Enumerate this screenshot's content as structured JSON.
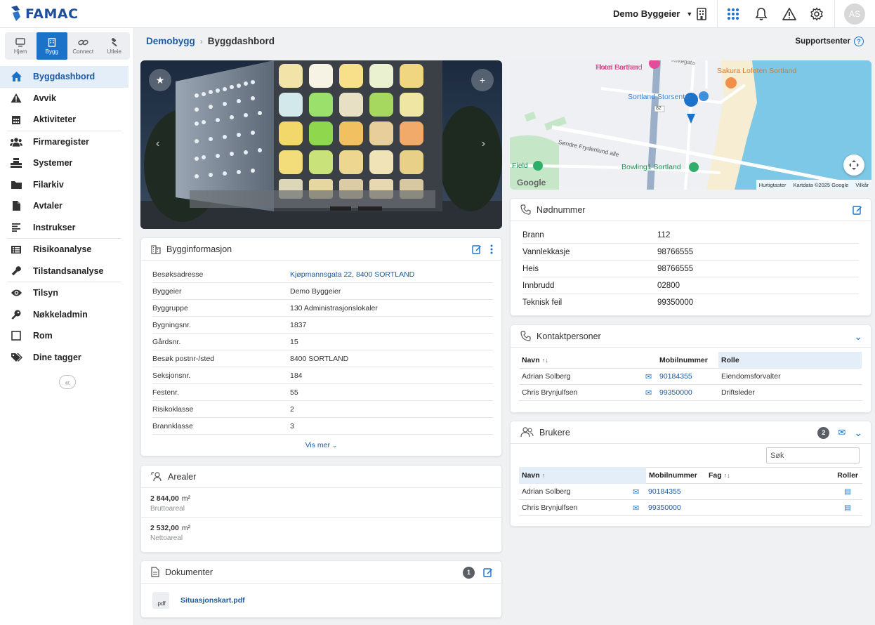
{
  "app": {
    "logo_text": "FAMAC"
  },
  "topbar": {
    "owner_select": "Demo Byggeier",
    "avatar_initials": "AS"
  },
  "modules": [
    {
      "label": "Hjem",
      "icon": "monitor-icon"
    },
    {
      "label": "Bygg",
      "icon": "building-icon",
      "active": true
    },
    {
      "label": "Connect",
      "icon": "link-icon"
    },
    {
      "label": "Utleie",
      "icon": "gavel-icon"
    }
  ],
  "nav": [
    {
      "label": "Byggdashbord",
      "icon": "home-icon",
      "active": true
    },
    {
      "label": "Avvik",
      "icon": "warning-icon"
    },
    {
      "label": "Aktiviteter",
      "icon": "calendar-icon"
    },
    {
      "label": "Firmaregister",
      "icon": "people-icon"
    },
    {
      "label": "Systemer",
      "icon": "cubes-icon"
    },
    {
      "label": "Filarkiv",
      "icon": "folder-icon"
    },
    {
      "label": "Avtaler",
      "icon": "file-icon"
    },
    {
      "label": "Instrukser",
      "icon": "lines-icon"
    },
    {
      "label": "Risikoanalyse",
      "icon": "list-icon"
    },
    {
      "label": "Tilstandsanalyse",
      "icon": "wrench-icon"
    },
    {
      "label": "Tilsyn",
      "icon": "eye-icon"
    },
    {
      "label": "Nøkkeladmin",
      "icon": "key-icon"
    },
    {
      "label": "Rom",
      "icon": "square-icon"
    },
    {
      "label": "Dine tagger",
      "icon": "tags-icon"
    }
  ],
  "breadcrumb": {
    "parent": "Demobygg",
    "current": "Byggdashbord"
  },
  "support": {
    "label": "Supportsenter"
  },
  "building_info": {
    "title": "Bygginformasjon",
    "rows": [
      {
        "key": "Besøksadresse",
        "value": "Kjøpmannsgata 22, 8400 SORTLAND",
        "link": true
      },
      {
        "key": "Byggeier",
        "value": "Demo Byggeier"
      },
      {
        "key": "Byggruppe",
        "value": "130 Administrasjonslokaler"
      },
      {
        "key": "Bygningsnr.",
        "value": "1837"
      },
      {
        "key": "Gårdsnr.",
        "value": "15"
      },
      {
        "key": "Besøk postnr-/sted",
        "value": "8400 SORTLAND"
      },
      {
        "key": "Seksjonsnr.",
        "value": "184"
      },
      {
        "key": "Festenr.",
        "value": "55"
      },
      {
        "key": "Risikoklasse",
        "value": "2"
      },
      {
        "key": "Brannklasse",
        "value": "3"
      }
    ],
    "show_more": "Vis mer"
  },
  "areas": {
    "title": "Arealer",
    "items": [
      {
        "value": "2 844,00",
        "unit": "m²",
        "label": "Bruttoareal"
      },
      {
        "value": "2 532,00",
        "unit": "m²",
        "label": "Nettoareal"
      }
    ]
  },
  "documents": {
    "title": "Dokumenter",
    "count": "1",
    "files": [
      {
        "ext": ".pdf",
        "name": "Situasjonskart.pdf"
      }
    ]
  },
  "map": {
    "labels": {
      "hotel": "Hotel Sortland",
      "hotel_top": "Thon Partner",
      "sakura": "Sakura Lofoten Sortland",
      "storsenter": "Sortland Storsenter",
      "road": "Søndre Frydenlund alle",
      "route": "82",
      "field": "Field",
      "bowling": "Bowling1 Sortland",
      "street_top": "Kirkegata",
      "google": "Google"
    },
    "footer": {
      "shortcuts": "Hurtigtaster",
      "mapdata": "Kartdata ©2025 Google",
      "terms": "Vilkår"
    }
  },
  "emergency": {
    "title": "Nødnummer",
    "rows": [
      {
        "key": "Brann",
        "value": "112"
      },
      {
        "key": "Vannlekkasje",
        "value": "98766555"
      },
      {
        "key": "Heis",
        "value": "98766555"
      },
      {
        "key": "Innbrudd",
        "value": "02800"
      },
      {
        "key": "Teknisk feil",
        "value": "99350000"
      }
    ]
  },
  "contacts": {
    "title": "Kontaktpersoner",
    "headers": {
      "name": "Navn",
      "mobile": "Mobilnummer",
      "role": "Rolle"
    },
    "rows": [
      {
        "name": "Adrian Solberg",
        "mobile": "90184355",
        "role": "Eiendomsforvalter"
      },
      {
        "name": "Chris Brynjulfsen",
        "mobile": "99350000",
        "role": "Driftsleder"
      }
    ]
  },
  "users": {
    "title": "Brukere",
    "count": "2",
    "search_placeholder": "Søk",
    "headers": {
      "name": "Navn",
      "mobile": "Mobilnummer",
      "discipline": "Fag",
      "roles": "Roller"
    },
    "rows": [
      {
        "name": "Adrian Solberg",
        "mobile": "90184355"
      },
      {
        "name": "Chris Brynjulfsen",
        "mobile": "99350000"
      }
    ]
  },
  "colors": {
    "primary": "#1c72c9",
    "link": "#1c5aa3",
    "active_bg": "#e3eef9"
  }
}
